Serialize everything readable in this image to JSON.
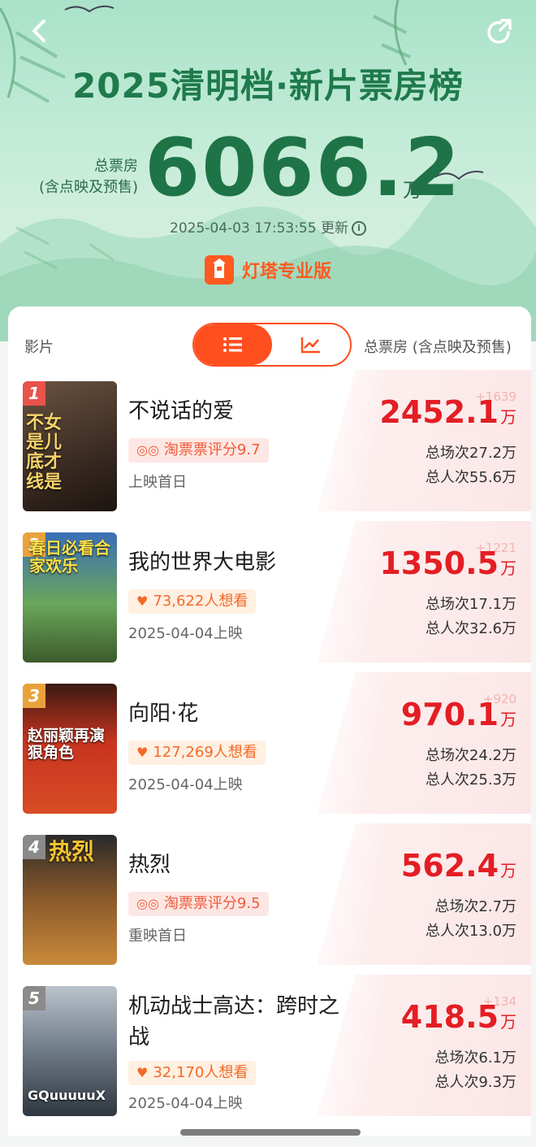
{
  "header": {
    "title": "2025清明档·新片票房榜",
    "total_label_line1": "总票房",
    "total_label_line2": "(含点映及预售)",
    "total_value": "6066.2",
    "total_unit": "万",
    "update_time": "2025-04-03 17:53:55 更新",
    "brand": "灯塔专业版"
  },
  "table": {
    "col_film": "影片",
    "col_box": "总票房 (含点映及预售)",
    "view_modes": [
      "list",
      "trend"
    ],
    "active_view": "list"
  },
  "movies": [
    {
      "rank": "1",
      "name": "不说话的爱",
      "tag_type": "rating",
      "tag_text": "淘票票评分9.7",
      "release": "上映首日",
      "box": "2452.1",
      "unit": "万",
      "delta": "+1639",
      "screenings": "总场次27.2万",
      "audience": "总人次55.6万",
      "poster_caption": "不女是儿底才线是",
      "rank_color": "#e8534a"
    },
    {
      "rank": "2",
      "name": "我的世界大电影",
      "tag_type": "want",
      "tag_text": "73,622人想看",
      "release": "2025-04-04上映",
      "box": "1350.5",
      "unit": "万",
      "delta": "+1221",
      "screenings": "总场次17.1万",
      "audience": "总人次32.6万",
      "poster_caption": "春日必看合家欢乐",
      "rank_color": "#e9a23b"
    },
    {
      "rank": "3",
      "name": "向阳·花",
      "tag_type": "want",
      "tag_text": "127,269人想看",
      "release": "2025-04-04上映",
      "box": "970.1",
      "unit": "万",
      "delta": "+920",
      "screenings": "总场次24.2万",
      "audience": "总人次25.3万",
      "poster_caption": "赵丽颖再演狠角色",
      "rank_color": "#e9a23b"
    },
    {
      "rank": "4",
      "name": "热烈",
      "tag_type": "rating",
      "tag_text": "淘票票评分9.5",
      "release": "重映首日",
      "box": "562.4",
      "unit": "万",
      "delta": "",
      "screenings": "总场次2.7万",
      "audience": "总人次13.0万",
      "poster_caption": "热烈",
      "rank_color": "#8a8a8a"
    },
    {
      "rank": "5",
      "name": "机动战士高达：跨时之战",
      "tag_type": "want",
      "tag_text": "32,170人想看",
      "release": "2025-04-04上映",
      "box": "418.5",
      "unit": "万",
      "delta": "+134",
      "screenings": "总场次6.1万",
      "audience": "总人次9.3万",
      "poster_caption": "GQuuuuuX",
      "rank_color": "#8a8a8a"
    }
  ],
  "colors": {
    "accent": "#ff4f1f",
    "box_red": "#e31e24",
    "title_green": "#1f7a4c"
  }
}
